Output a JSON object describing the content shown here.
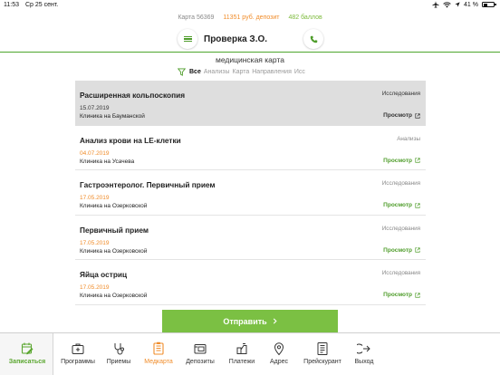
{
  "status_bar": {
    "time": "11:53",
    "date": "Ср 25 сент.",
    "battery": "41 %",
    "battery_level_percent": 41
  },
  "header": {
    "card_number": "Карта 56369",
    "deposit": "11351 руб. депозит",
    "points": "482 баллов",
    "title": "Проверка З.О."
  },
  "section_title": "медицинская карта",
  "filters": [
    {
      "label": "Все",
      "active": true
    },
    {
      "label": "Анализы",
      "active": false
    },
    {
      "label": "Карта",
      "active": false
    },
    {
      "label": "Направления",
      "active": false
    },
    {
      "label": "Исс",
      "active": false
    }
  ],
  "records": [
    {
      "name": "Расширенная кольпоскопия",
      "type": "Исследования",
      "date": "15.07.2019",
      "clinic": "Клиника на Бауманской",
      "action": "Просмотр",
      "selected": true
    },
    {
      "name": "Анализ крови на LE-клетки",
      "type": "Анализы",
      "date": "04.07.2019",
      "clinic": "Клиника на Усачева",
      "action": "Просмотр",
      "selected": false
    },
    {
      "name": "Гастроэнтеролог. Первичный прием",
      "type": "Исследования",
      "date": "17.05.2019",
      "clinic": "Клиника на Озерковской",
      "action": "Просмотр",
      "selected": false
    },
    {
      "name": "Первичный прием",
      "type": "Исследования",
      "date": "17.05.2019",
      "clinic": "Клиника на Озерковской",
      "action": "Просмотр",
      "selected": false
    },
    {
      "name": "Яйца остриц",
      "type": "Исследования",
      "date": "17.05.2019",
      "clinic": "Клиника на Озерковской",
      "action": "Просмотр",
      "selected": false
    }
  ],
  "send_button": "Отправить",
  "tabs": [
    {
      "label": "Записаться",
      "icon": "calendar-add-icon"
    },
    {
      "label": "Программы",
      "icon": "briefcase-icon"
    },
    {
      "label": "Приемы",
      "icon": "stethoscope-icon"
    },
    {
      "label": "Медкарта",
      "icon": "medical-card-icon"
    },
    {
      "label": "Депозиты",
      "icon": "wallet-icon"
    },
    {
      "label": "Платежи",
      "icon": "payment-icon"
    },
    {
      "label": "Адрес",
      "icon": "location-pin-icon"
    },
    {
      "label": "Прейскурант",
      "icon": "price-list-icon"
    },
    {
      "label": "Выход",
      "icon": "logout-icon"
    }
  ],
  "colors": {
    "brand_green": "#7bc043",
    "accent_orange": "#f08c2a",
    "selected_row": "#dedede"
  }
}
